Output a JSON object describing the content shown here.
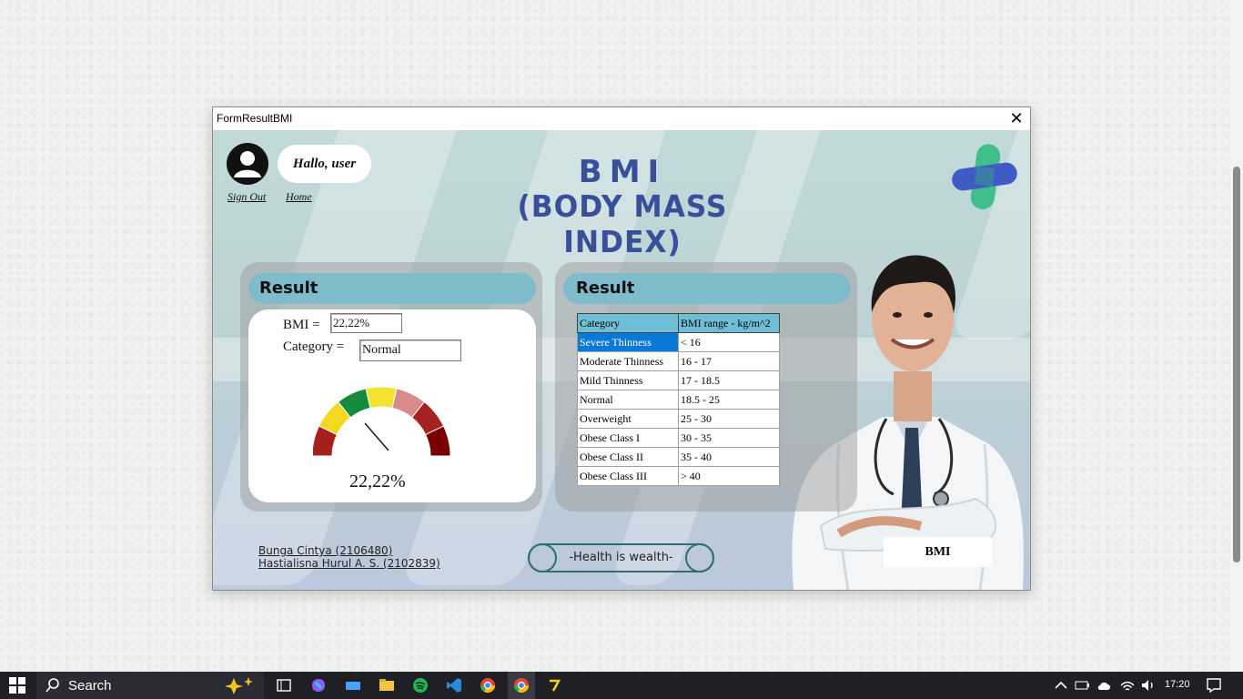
{
  "window": {
    "title": "FormResultBMI",
    "close_glyph": "✕"
  },
  "header": {
    "greeting": "Hallo, user",
    "sign_out": "Sign Out",
    "home": "Home",
    "title_line1": "BMI",
    "title_line2": "(BODY MASS INDEX)"
  },
  "left_panel": {
    "heading": "Result",
    "bmi_label": "BMI =",
    "bmi_value": "22,22%",
    "category_label": "Category =",
    "category_value": "Normal",
    "gauge_value": "22,22%",
    "gauge_colors": [
      "#a61f1f",
      "#f2d91f",
      "#138a3c",
      "#f5e22e",
      "#d98a8a",
      "#a42222",
      "#7a0000"
    ]
  },
  "right_panel": {
    "heading": "Result",
    "table": {
      "headers": [
        "Category",
        "BMI range - kg/m^2"
      ],
      "rows": [
        [
          "Severe Thinness",
          "< 16"
        ],
        [
          "Moderate Thinness",
          "16 - 17"
        ],
        [
          "Mild Thinness",
          "17 - 18.5"
        ],
        [
          "Normal",
          "18.5 - 25"
        ],
        [
          "Overweight",
          "25 - 30"
        ],
        [
          "Obese Class I",
          "30 - 35"
        ],
        [
          "Obese Class II",
          "35 - 40"
        ],
        [
          "Obese Class III",
          "> 40"
        ]
      ],
      "selected_row": "Severe Thinness"
    }
  },
  "footer": {
    "credit1": "Bunga Cintya (2106480)",
    "credit2": "Hastialisna Hurul A. S. (2102839)",
    "slogan": "-Health is wealth-",
    "bmi_button": "BMI"
  },
  "taskbar": {
    "search_placeholder": "Search",
    "time": "17:20",
    "accent": "#1f2026"
  }
}
